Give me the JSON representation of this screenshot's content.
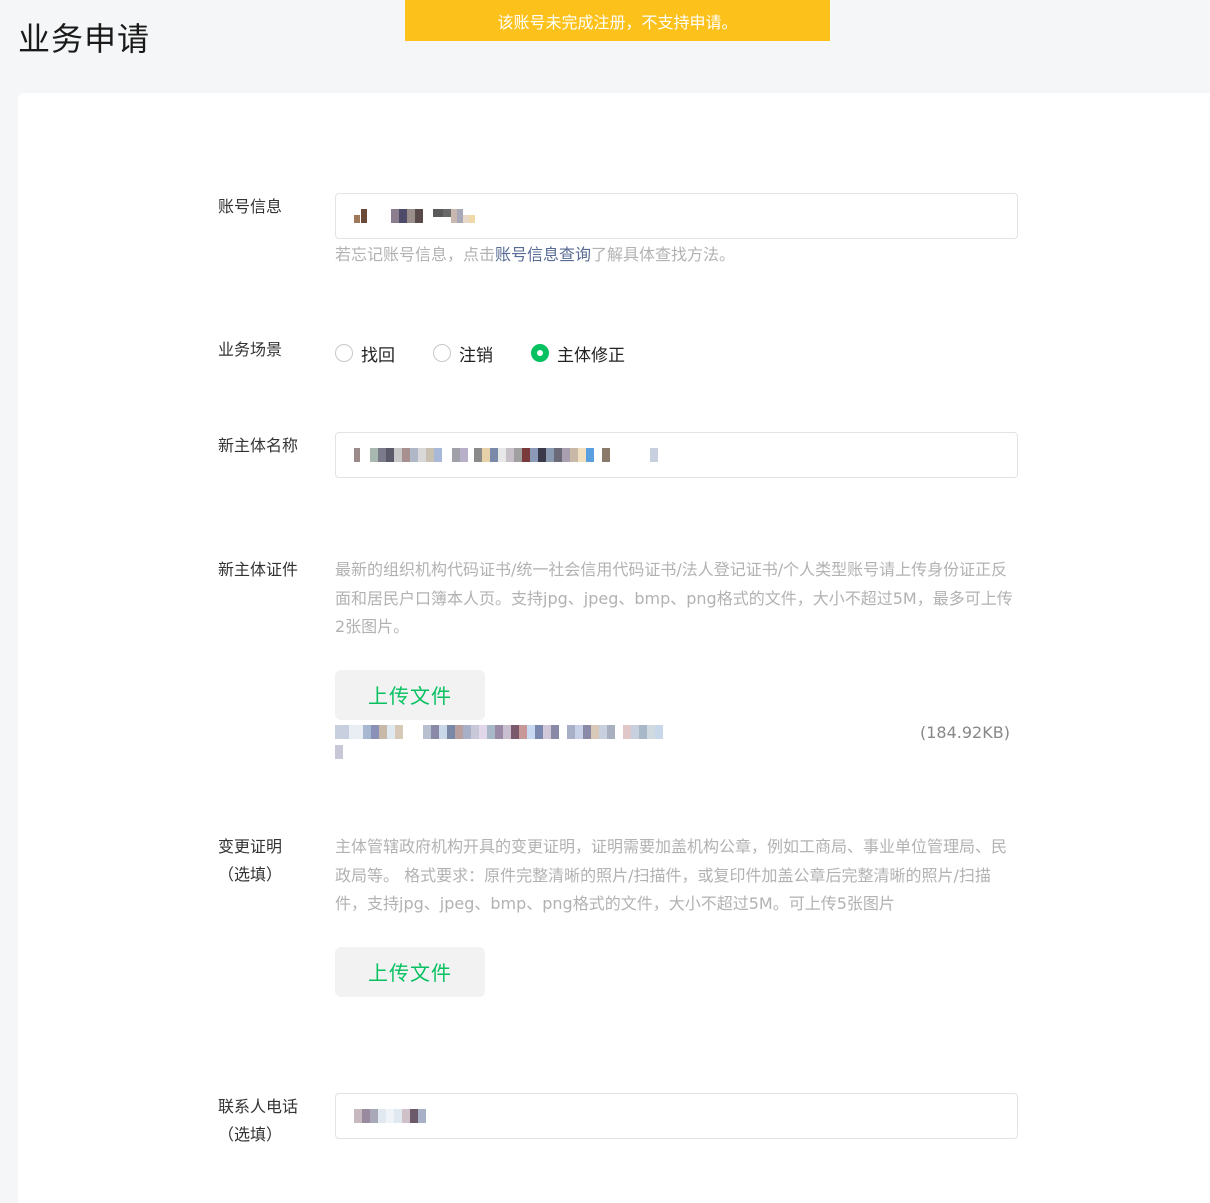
{
  "page": {
    "title": "业务申请"
  },
  "toast": {
    "message": "该账号未完成注册，不支持申请。",
    "color": "#fcc21b"
  },
  "form": {
    "account": {
      "label": "账号信息",
      "hint_prefix": "若忘记账号信息，点击",
      "hint_link": "账号信息查询",
      "hint_suffix": "了解具体查找方法。"
    },
    "scene": {
      "label": "业务场景",
      "options": [
        {
          "label": "找回",
          "checked": false
        },
        {
          "label": "注销",
          "checked": false
        },
        {
          "label": "主体修正",
          "checked": true
        }
      ]
    },
    "new_name": {
      "label": "新主体名称"
    },
    "new_cert": {
      "label": "新主体证件",
      "description": "最新的组织机构代码证书/统一社会信用代码证书/法人登记证书/个人类型账号请上传身份证正反面和居民户口簿本人页。支持jpg、jpeg、bmp、png格式的文件，大小不超过5M，最多可上传2张图片。",
      "upload_label": "上传文件",
      "file_size": "(184.92KB)"
    },
    "change_proof": {
      "label": "变更证明（选填）",
      "description": "主体管辖政府机构开具的变更证明，证明需要加盖机构公章，例如工商局、事业单位管理局、民政局等。 格式要求：原件完整清晰的照片/扫描件，或复印件加盖公章后完整清晰的照片/扫描件，支持jpg、jpeg、bmp、png格式的文件，大小不超过5M。可上传5张图片",
      "upload_label": "上传文件"
    },
    "contact_phone": {
      "label": "联系人电话（选填）"
    }
  },
  "colors": {
    "accent": "#07c160",
    "link": "#576b95",
    "hint": "#b2b2b2"
  }
}
